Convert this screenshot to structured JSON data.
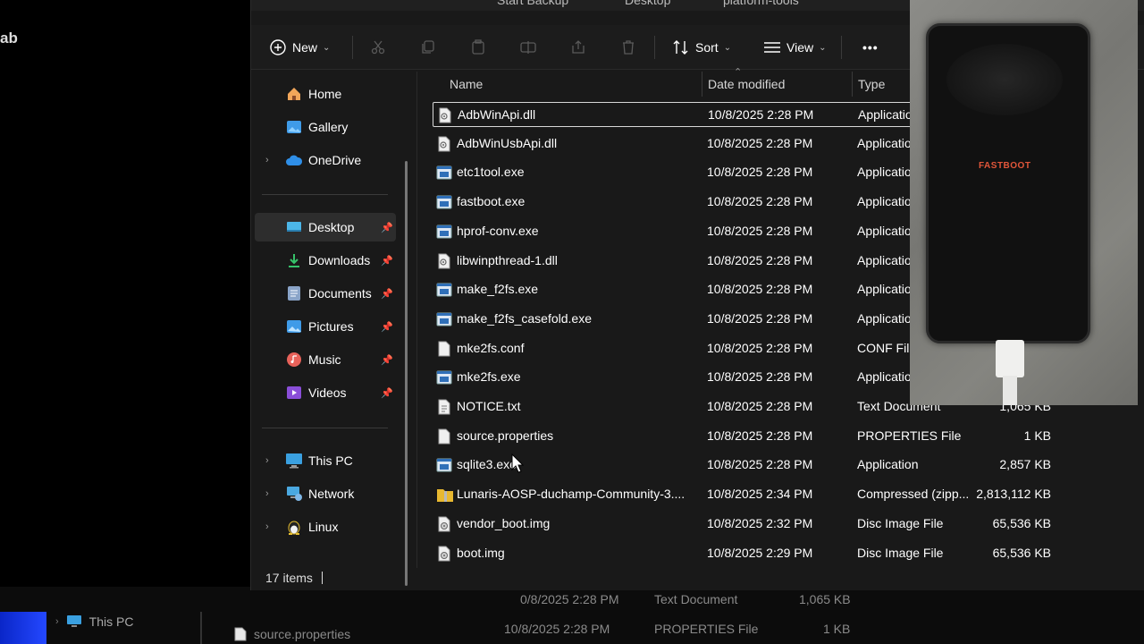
{
  "background": {
    "corner_text": "ab",
    "strip": {
      "nav_this_pc": "This PC",
      "row1_date": "0/8/2025 2:28 PM",
      "row1_type": "Text Document",
      "row1_size": "1,065 KB",
      "row2_name": "source.properties",
      "row2_date": "10/8/2025 2:28 PM",
      "row2_type": "PROPERTIES File",
      "row2_size": "1 KB"
    }
  },
  "titlebar": {
    "fragment_1": "Start Backup",
    "fragment_2": "Desktop",
    "fragment_3": "platform-tools"
  },
  "toolbar": {
    "new_label": "New",
    "sort_label": "Sort",
    "view_label": "View",
    "more_label": "•••"
  },
  "sidebar": {
    "home": "Home",
    "gallery": "Gallery",
    "onedrive": "OneDrive",
    "desktop": "Desktop",
    "downloads": "Downloads",
    "documents": "Documents",
    "pictures": "Pictures",
    "music": "Music",
    "videos": "Videos",
    "this_pc": "This PC",
    "network": "Network",
    "linux": "Linux"
  },
  "columns": {
    "name": "Name",
    "date_modified": "Date modified",
    "type": "Type"
  },
  "files": [
    {
      "name": "AdbWinApi.dll",
      "date": "10/8/2025 2:28 PM",
      "type": "Applicatio",
      "size": "",
      "icon": "dll-icon"
    },
    {
      "name": "AdbWinUsbApi.dll",
      "date": "10/8/2025 2:28 PM",
      "type": "Applicatio",
      "size": "",
      "icon": "dll-icon"
    },
    {
      "name": "etc1tool.exe",
      "date": "10/8/2025 2:28 PM",
      "type": "Applicatio",
      "size": "",
      "icon": "exe-icon"
    },
    {
      "name": "fastboot.exe",
      "date": "10/8/2025 2:28 PM",
      "type": "Applicatio",
      "size": "",
      "icon": "exe-icon"
    },
    {
      "name": "hprof-conv.exe",
      "date": "10/8/2025 2:28 PM",
      "type": "Applicatio",
      "size": "",
      "icon": "exe-icon"
    },
    {
      "name": "libwinpthread-1.dll",
      "date": "10/8/2025 2:28 PM",
      "type": "Applicatio",
      "size": "",
      "icon": "dll-icon"
    },
    {
      "name": "make_f2fs.exe",
      "date": "10/8/2025 2:28 PM",
      "type": "Applicatio",
      "size": "",
      "icon": "exe-icon"
    },
    {
      "name": "make_f2fs_casefold.exe",
      "date": "10/8/2025 2:28 PM",
      "type": "Applicatio",
      "size": "",
      "icon": "exe-icon"
    },
    {
      "name": "mke2fs.conf",
      "date": "10/8/2025 2:28 PM",
      "type": "CONF File",
      "size": "",
      "icon": "doc-icon"
    },
    {
      "name": "mke2fs.exe",
      "date": "10/8/2025 2:28 PM",
      "type": "Applicatio",
      "size": "",
      "icon": "exe-icon"
    },
    {
      "name": "NOTICE.txt",
      "date": "10/8/2025 2:28 PM",
      "type": "Text Document",
      "size": "1,065 KB",
      "icon": "text-icon"
    },
    {
      "name": "source.properties",
      "date": "10/8/2025 2:28 PM",
      "type": "PROPERTIES File",
      "size": "1 KB",
      "icon": "doc-icon"
    },
    {
      "name": "sqlite3.exe",
      "date": "10/8/2025 2:28 PM",
      "type": "Application",
      "size": "2,857 KB",
      "icon": "exe-icon"
    },
    {
      "name": "Lunaris-AOSP-duchamp-Community-3....",
      "date": "10/8/2025 2:34 PM",
      "type": "Compressed (zipp...",
      "size": "2,813,112 KB",
      "icon": "zip-folder-icon"
    },
    {
      "name": "vendor_boot.img",
      "date": "10/8/2025 2:32 PM",
      "type": "Disc Image File",
      "size": "65,536 KB",
      "icon": "disc-image-icon"
    },
    {
      "name": "boot.img",
      "date": "10/8/2025 2:29 PM",
      "type": "Disc Image File",
      "size": "65,536 KB",
      "icon": "disc-image-icon"
    }
  ],
  "status": {
    "item_count": "17 items"
  },
  "camera": {
    "phone_text": "FASTBOOT"
  },
  "colors": {
    "window_bg": "#191919",
    "accent_blue": "#4aa3ff",
    "fastboot_text": "#e2563a"
  }
}
